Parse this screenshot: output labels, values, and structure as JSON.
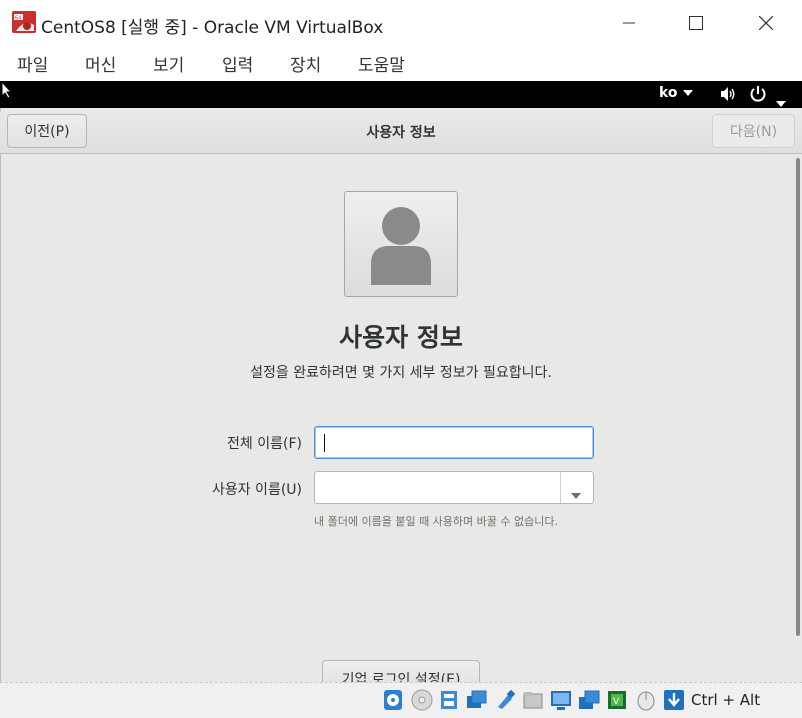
{
  "window": {
    "title": "CentOS8 [실행 중] - Oracle VM VirtualBox"
  },
  "menu": [
    "파일",
    "머신",
    "보기",
    "입력",
    "장치",
    "도움말"
  ],
  "topbar": {
    "keyboard_layout": "ko"
  },
  "header": {
    "prev_label": "이전(P)",
    "title": "사용자 정보",
    "next_label": "다음(N)",
    "next_enabled": false
  },
  "main": {
    "heading": "사용자 정보",
    "subtitle": "설정을 완료하려면 몇 가지 세부 정보가 필요합니다.",
    "full_name_label": "전체 이름(F)",
    "full_name_value": "",
    "username_label": "사용자 이름(U)",
    "username_value": "",
    "username_hint": "내 폴더에 이름을 붙일 때 사용하며 바꿀 수 없습니다.",
    "enterprise_login_label": "기업 로그인 설정(E)"
  },
  "statusbar": {
    "host_key": "Ctrl + Alt",
    "icons": [
      "hard-disk-icon",
      "optical-disk-icon",
      "audio-icon",
      "network-icon",
      "usb-icon",
      "shared-folders-icon",
      "display-icon",
      "video-capture-icon",
      "cpu-activity-icon",
      "mouse-integration-icon",
      "host-key-arrow-icon"
    ]
  },
  "colors": {
    "accent": "#4a90d9",
    "guest_bg": "#e8e8e7",
    "topbar_bg": "#000000"
  }
}
